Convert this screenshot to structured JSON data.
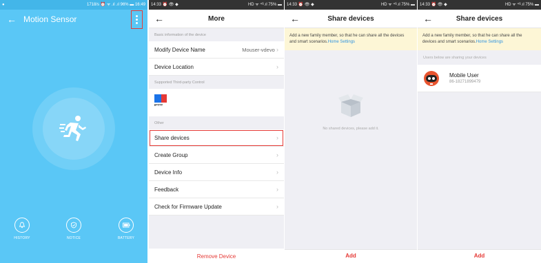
{
  "screen1": {
    "status_left": "●",
    "status_right": "1718/s ⏰ ᯤ .ıl .ıl 96% ▬ 16:49",
    "title": "Motion Sensor",
    "bottom_buttons": [
      {
        "label": "HISTORY",
        "icon": "bell-icon"
      },
      {
        "label": "NOTICE",
        "icon": "shield-icon"
      },
      {
        "label": "BATTERY",
        "icon": "battery-icon"
      }
    ]
  },
  "screen2": {
    "status_left": "14:33 ⏰ 👁 ◆",
    "status_right": "HD ᯤ ⁴ᴳ.ıl 75% ▬",
    "title": "More",
    "section_basic": "Basic information of the device",
    "modify_name_label": "Modify Device Name",
    "modify_name_value": "Mouser-vdevo",
    "device_location": "Device Location",
    "section_thirdparty": "Supported Third-party Control",
    "ifttt_label": "IFTTT",
    "section_other": "Other",
    "rows": [
      "Share devices",
      "Create Group",
      "Device Info",
      "Feedback",
      "Check for Firmware Update"
    ],
    "remove_label": "Remove Device"
  },
  "screen3": {
    "status_left": "14:33 ⏰ 👁 ◆",
    "status_right": "HD ᯤ ⁴ᴳ.ıl 75% ▬",
    "title": "Share devices",
    "banner_text": "Add a new family member, so that he can share all the devices and smart scenarios.",
    "banner_link": "Home Settings",
    "empty_text": "No shared devices, please add it.",
    "add_label": "Add"
  },
  "screen4": {
    "status_left": "14:33 ⏰ 👁 ◆",
    "status_right": "HD ᯤ ⁴ᴳ.ıl 75% ▬",
    "title": "Share devices",
    "banner_text": "Add a new family member, so that he can share all the devices and smart scenarios.",
    "banner_link": "Home Settings",
    "sharing_header": "Users below are sharing your devices",
    "user_name": "Mobile User",
    "user_phone": "86-18271899479",
    "add_label": "Add"
  },
  "colors": {
    "sensor_bg": "#5ac7f6",
    "accent_red": "#e53935",
    "link_blue": "#2f93e0",
    "banner_bg": "#fdf6d6"
  }
}
